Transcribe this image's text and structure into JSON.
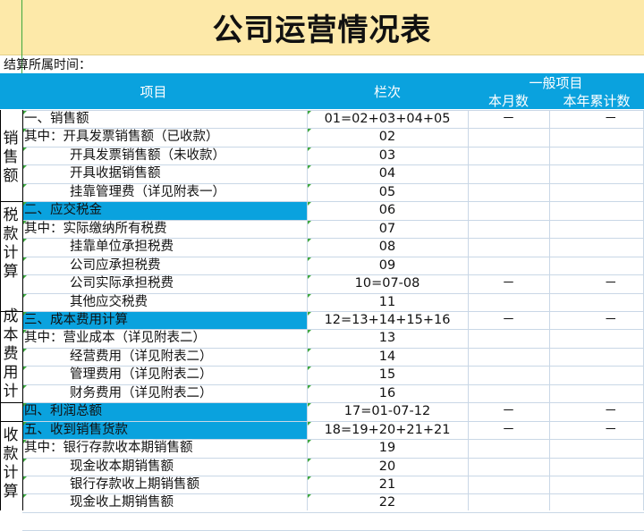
{
  "title": "公司运营情况表",
  "date_label": "结算所属时间：",
  "colors": {
    "header_bg": "#0aa2de",
    "title_bg": "#fde9a9",
    "grid": "#c9d7e6"
  },
  "header": {
    "item": "项目",
    "seq": "栏次",
    "group": "一般项目",
    "month": "本月数",
    "ytd": "本年累计数"
  },
  "categories": [
    {
      "label": "销售额"
    },
    {
      "label": "税款计算"
    },
    {
      "label": "成本费用计算"
    },
    {
      "label": "收款计算"
    }
  ],
  "rows": [
    {
      "item": "一、销售额",
      "code": "01=02+03+04+05",
      "month": "－",
      "ytd": "－"
    },
    {
      "item": "其中：开具发票销售额（已收款）",
      "code": "02",
      "month": "",
      "ytd": ""
    },
    {
      "item": "开具发票销售额（未收款）",
      "code": "03",
      "month": "",
      "ytd": ""
    },
    {
      "item": "开具收据销售额",
      "code": "04",
      "month": "",
      "ytd": ""
    },
    {
      "item": "挂靠管理费（详见附表一）",
      "code": "05",
      "month": "",
      "ytd": ""
    },
    {
      "item": "二、应交税金",
      "code": "06",
      "month": "",
      "ytd": ""
    },
    {
      "item": "其中：实际缴纳所有税费",
      "code": "07",
      "month": "",
      "ytd": ""
    },
    {
      "item": "挂靠单位承担税费",
      "code": "08",
      "month": "",
      "ytd": ""
    },
    {
      "item": "公司应承担税费",
      "code": "09",
      "month": "",
      "ytd": ""
    },
    {
      "item": "公司实际承担税费",
      "code": "10=07-08",
      "month": "－",
      "ytd": "－"
    },
    {
      "item": "其他应交税费",
      "code": "11",
      "month": "",
      "ytd": ""
    },
    {
      "item": "三、成本费用计算",
      "code": "12=13+14+15+16",
      "month": "－",
      "ytd": "－"
    },
    {
      "item": "其中：营业成本（详见附表二）",
      "code": "13",
      "month": "",
      "ytd": ""
    },
    {
      "item": "经营费用（详见附表二）",
      "code": "14",
      "month": "",
      "ytd": ""
    },
    {
      "item": "管理费用（详见附表二）",
      "code": "15",
      "month": "",
      "ytd": ""
    },
    {
      "item": "财务费用（详见附表二）",
      "code": "16",
      "month": "",
      "ytd": ""
    },
    {
      "item": "四、利润总额",
      "code": "17=01-07-12",
      "month": "－",
      "ytd": "－"
    },
    {
      "item": "五、收到销售货款",
      "code": "18=19+20+21+21",
      "month": "－",
      "ytd": "－"
    },
    {
      "item": "其中：银行存款收本期销售额",
      "code": "19",
      "month": "",
      "ytd": ""
    },
    {
      "item": "现金收本期销售额",
      "code": "20",
      "month": "",
      "ytd": ""
    },
    {
      "item": "银行存款收上期销售额",
      "code": "21",
      "month": "",
      "ytd": ""
    },
    {
      "item": "现金收上期销售额",
      "code": "22",
      "month": "",
      "ytd": ""
    }
  ]
}
